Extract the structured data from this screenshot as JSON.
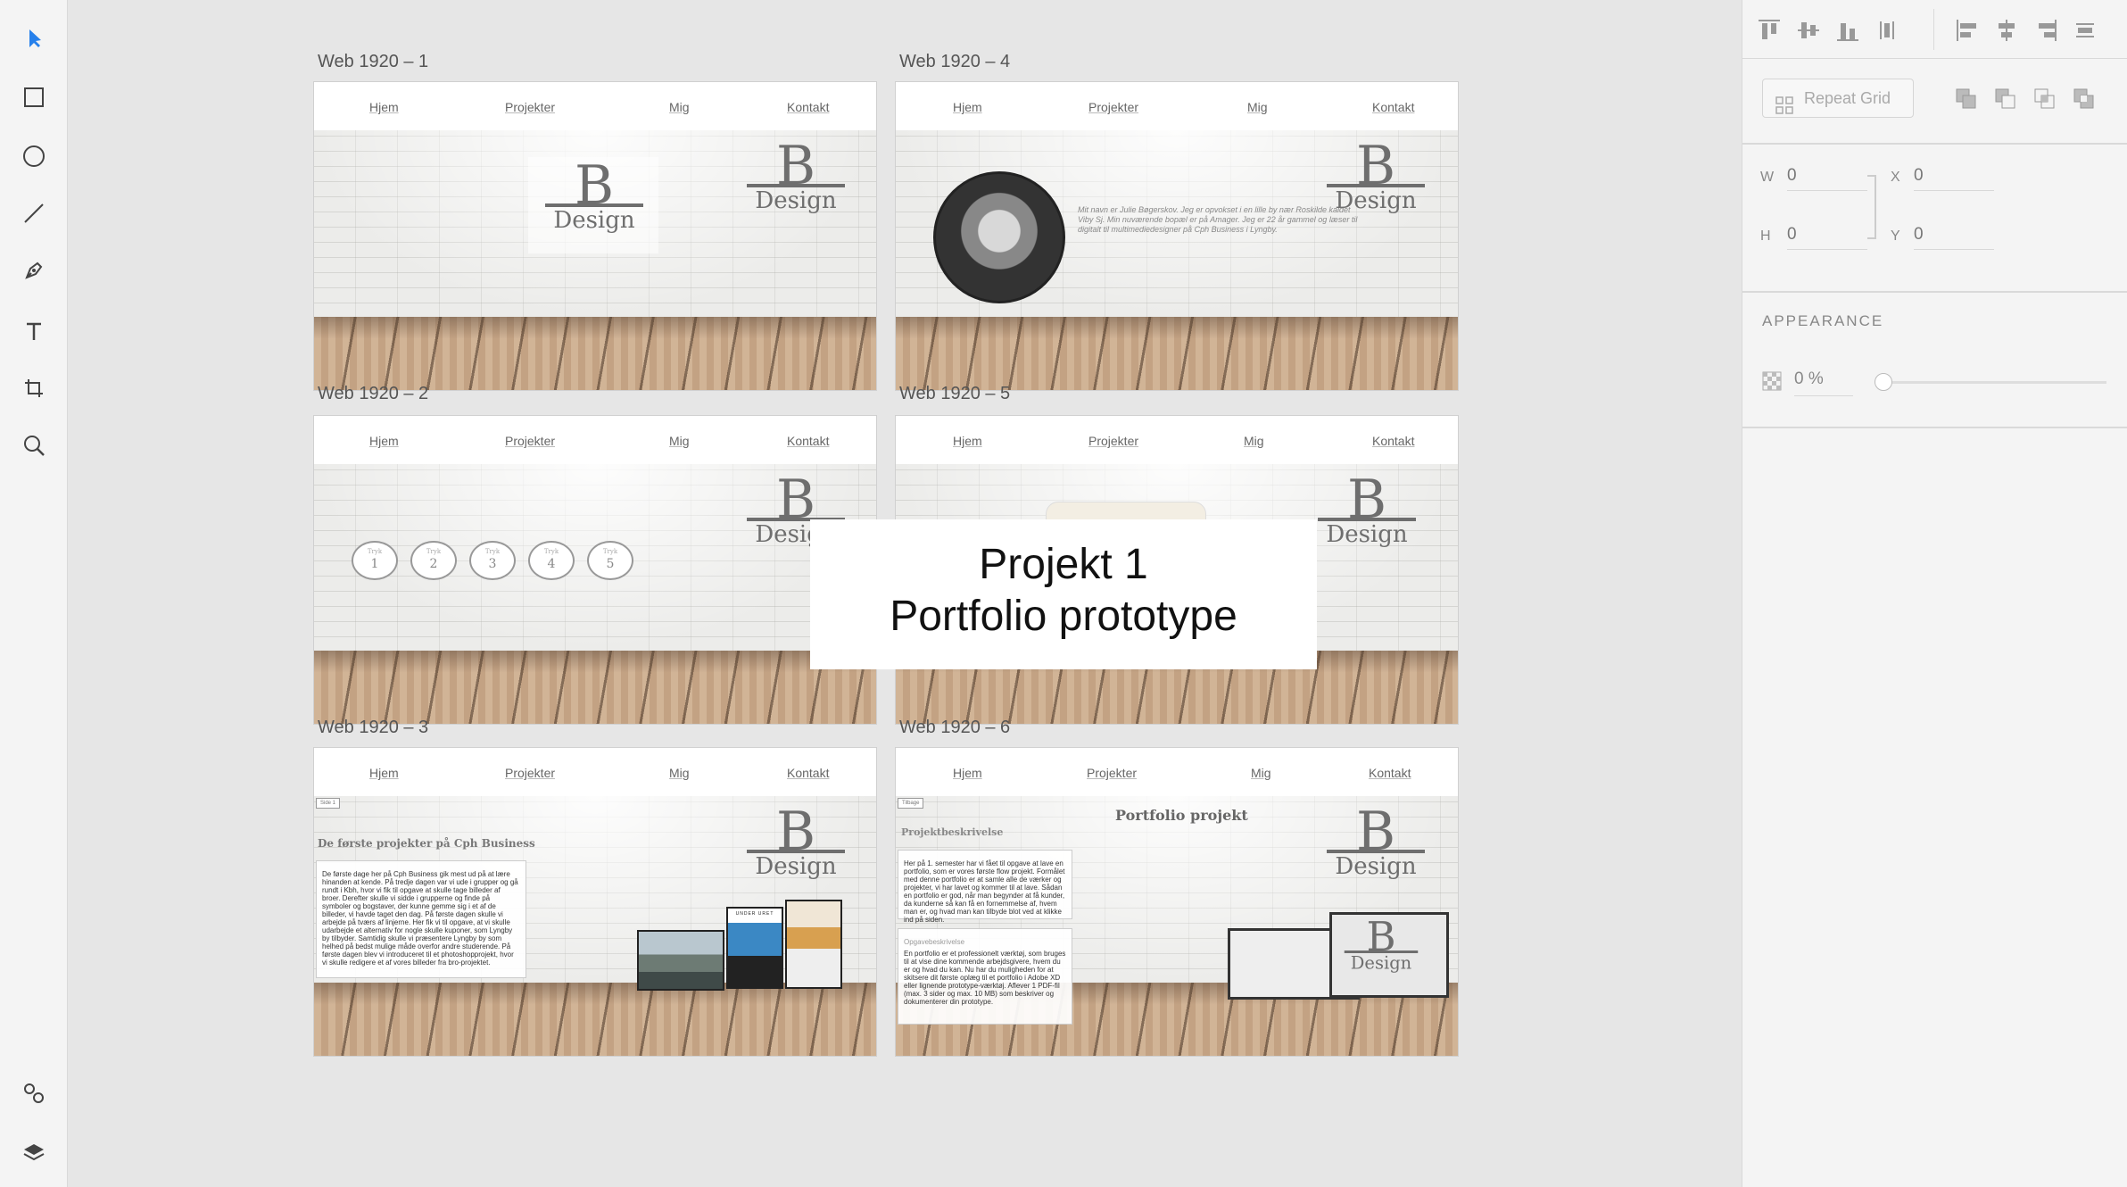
{
  "toolbar": {
    "tools": [
      "select-tool",
      "rectangle-tool",
      "ellipse-tool",
      "line-tool",
      "pen-tool",
      "text-tool",
      "artboard-tool",
      "zoom-tool"
    ],
    "bottom_tools": [
      "assets-panel",
      "layers-panel"
    ]
  },
  "artboards": [
    {
      "label": "Web 1920 – 1"
    },
    {
      "label": "Web 1920 – 4"
    },
    {
      "label": "Web 1920 – 2"
    },
    {
      "label": "Web 1920 – 5"
    },
    {
      "label": "Web 1920 – 3"
    },
    {
      "label": "Web 1920 – 6"
    }
  ],
  "nav": {
    "home": "Hjem",
    "projects": "Projekter",
    "me": "Mig",
    "contact": "Kontakt"
  },
  "logo": {
    "letter": "B",
    "word": "Design"
  },
  "about_text": "Mit navn er Julie Bøgerskov. Jeg er opvokset i en lille by nær Roskilde kaldet Viby Sj. Min nuværende bopæl er på Amager. Jeg er 22 år gammel og læser til digitalt til multimediedesigner på Cph Business i Lyngby.",
  "project_buttons": [
    "1",
    "2",
    "3",
    "4",
    "5"
  ],
  "project_button_caption": "Tryk",
  "ab3": {
    "heading": "De første projekter på Cph Business",
    "body": "De første dage her på Cph Business gik mest ud på at lære hinanden at kende. På tredje dagen var vi ude i grupper og gå rundt i Kbh, hvor vi fik til opgave at skulle tage billeder af broer. Derefter skulle vi sidde i grupperne og finde på symboler og bogstaver, der kunne gemme sig i et af de billeder, vi havde taget den dag. På første dagen skulle vi arbejde på tværs af linjerne. Her fik vi til opgave, at vi skulle udarbejde et alternativ for nogle skulle kuponer, som Lyngby by tilbyder. Samtidig skulle vi præsentere Lyngby by som helhed på bedst mulige måde overfor andre studerende. På første dagen blev vi introduceret til et photoshopprojekt, hvor vi skulle redigere et af vores billeder fra bro-projektet.",
    "mini_label": "Side 1",
    "screen_title": "UNDER URET"
  },
  "ab6": {
    "title": "Portfolio projekt",
    "subtitle": "Projektbeskrivelse",
    "mini_label": "Tilbage",
    "box1": "Her på 1. semester har vi fået til opgave at lave en portfolio, som er vores første flow projekt. Formålet med denne portfolio er at samle alle de værker og projekter, vi har lavet og kommer til at lave. Sådan en portfolio er god, når man begynder at få kunder, da kunderne så kan få en fornemmelse af, hvem man er, og hvad man kan tilbyde blot ved at klikke ind på siden.",
    "box2_title": "Opgavebeskrivelse",
    "box2": "En portfolio er et professionelt værktøj, som bruges til at vise dine kommende arbejdsgivere, hvem du er og hvad du kan. Nu har du muligheden for at skitsere dit første oplæg til et portfolio i Adobe XD eller lignende prototype-værktøj. Aflever 1 PDF-fil (max. 3 sider og max. 10 MB) som beskriver og dokumenterer din prototype."
  },
  "overlay": {
    "line1": "Projekt 1",
    "line2": "Portfolio prototype"
  },
  "panel": {
    "repeat_grid": "Repeat Grid",
    "w_label": "W",
    "w_value": "0",
    "h_label": "H",
    "h_value": "0",
    "x_label": "X",
    "x_value": "0",
    "y_label": "Y",
    "y_value": "0",
    "appearance_title": "APPEARANCE",
    "opacity": "0 %",
    "opacity_level": 0
  },
  "colors": {
    "accent": "#2680eb",
    "canvas": "#e6e6e6",
    "panel": "#f4f4f4"
  }
}
